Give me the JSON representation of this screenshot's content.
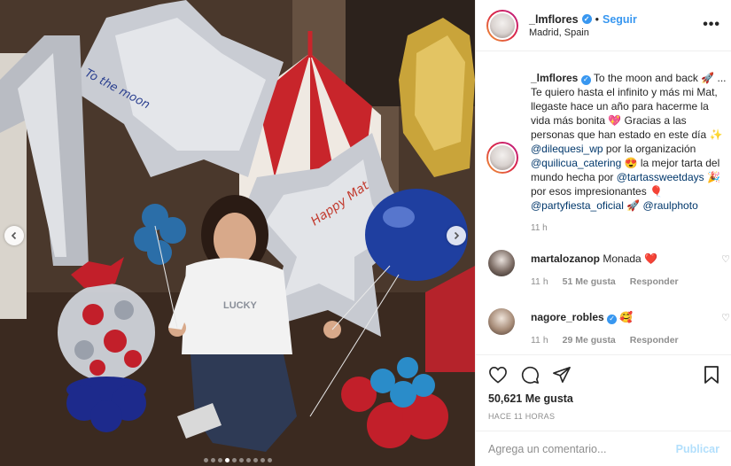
{
  "post": {
    "username": "_lmflores",
    "location": "Madrid, Spain",
    "follow_label": "Seguir",
    "separator": "•",
    "more_label": "•••"
  },
  "caption": {
    "username": "_lmflores",
    "text_1": "To the moon and back 🚀 ... Te quiero hasta el infinito y más mi Mat, llegaste hace un año para hacerme la vida más bonita 💖 Gracias a las personas que han estado en este día ✨ ",
    "mention_1": "@dilequesi_wp",
    "text_2": " por la organización ",
    "mention_2": "@quilicua_catering",
    "text_3": " 😍 la mejor tarta del mundo hecha por ",
    "mention_3": "@tartassweetdays",
    "text_4": " 🎉 por esos impresionantes 🎈 ",
    "mention_4": "@partyfiesta_oficial",
    "text_5": " 🚀 ",
    "mention_5": "@raulphoto",
    "time": "11 h"
  },
  "comments": [
    {
      "username": "martalozanop",
      "text": "Monada ❤️",
      "time": "11 h",
      "likes": "51 Me gusta",
      "reply": "Responder"
    },
    {
      "username": "nagore_robles",
      "text": "🥰",
      "time": "11 h",
      "likes": "29 Me gusta",
      "reply": "Responder"
    }
  ],
  "actions": {
    "likes_count": "50,621 Me gusta",
    "time_ago": "HACE 11 HORAS"
  },
  "comment_box": {
    "placeholder": "Agrega un comentario...",
    "publish_label": "Publicar"
  },
  "carousel": {
    "total_slides": 10,
    "active_slide": 3
  },
  "photo_scene": {
    "balloon_texts": [
      "To the moon",
      "Happy Mat"
    ],
    "shirt_text": "LUCKY"
  }
}
